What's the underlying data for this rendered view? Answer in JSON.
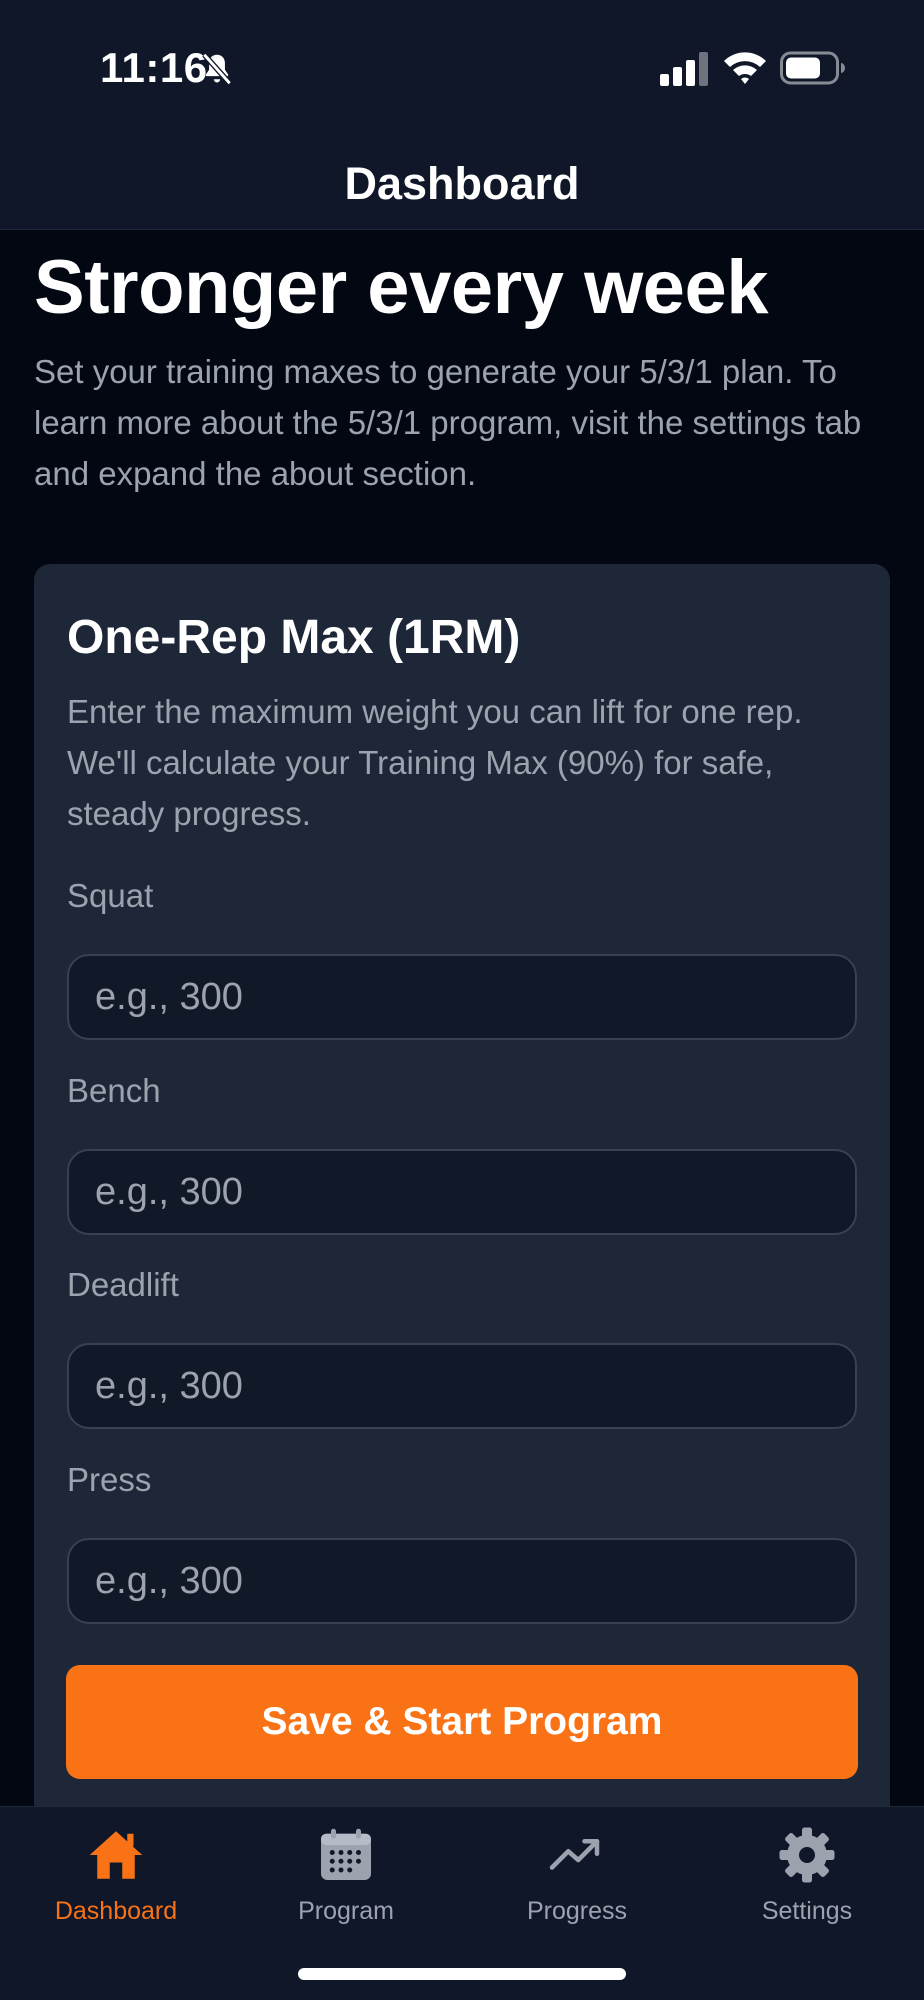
{
  "status_bar": {
    "time": "11:16"
  },
  "header": {
    "title": "Dashboard"
  },
  "hero": {
    "title": "Stronger every week",
    "subtitle": "Set your training maxes to generate your 5/3/1 plan. To learn more about the 5/3/1 program, visit the settings tab and expand the about section."
  },
  "card": {
    "title": "One-Rep Max (1RM)",
    "description": "Enter the maximum weight you can lift for one rep. We'll calculate your Training Max (90%) for safe, steady progress.",
    "fields": [
      {
        "label": "Squat",
        "placeholder": "e.g., 300",
        "value": ""
      },
      {
        "label": "Bench",
        "placeholder": "e.g., 300",
        "value": ""
      },
      {
        "label": "Deadlift",
        "placeholder": "e.g., 300",
        "value": ""
      },
      {
        "label": "Press",
        "placeholder": "e.g., 300",
        "value": ""
      }
    ],
    "submit_label": "Save & Start Program"
  },
  "tabs": [
    {
      "label": "Dashboard",
      "icon": "home-icon",
      "active": true
    },
    {
      "label": "Program",
      "icon": "calendar-icon",
      "active": false
    },
    {
      "label": "Progress",
      "icon": "trending-up-icon",
      "active": false
    },
    {
      "label": "Settings",
      "icon": "gear-icon",
      "active": false
    }
  ],
  "colors": {
    "accent": "#f97316",
    "background": "#030712",
    "card": "#1e2737",
    "header": "#0f1729",
    "muted_text": "#9ca3af"
  }
}
